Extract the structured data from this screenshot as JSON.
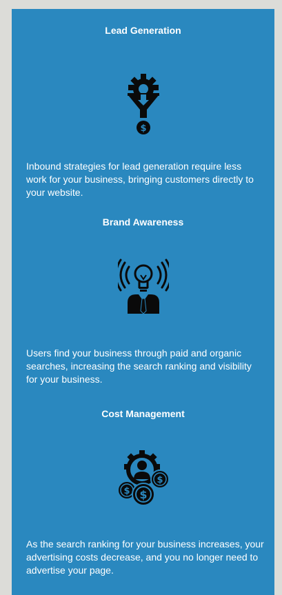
{
  "sections": [
    {
      "title": "Lead Generation",
      "icon": "gear-funnel-dollar-icon",
      "description": "Inbound strategies for lead generation require less work for your business, bringing customers directly to your website."
    },
    {
      "title": "Brand Awareness",
      "icon": "lightbulb-person-broadcast-icon",
      "description": "Users find your business through paid and organic searches, increasing the search ranking and visibility for your business."
    },
    {
      "title": "Cost Management",
      "icon": "gear-coins-person-icon",
      "description": "As the search ranking for your business increases, your advertising costs decrease, and you no longer need to advertise your page."
    }
  ],
  "colors": {
    "page_background": "#dcdcd8",
    "panel_background": "#2a88bf",
    "text": "#ffffff",
    "icon": "#0a0a0a"
  }
}
